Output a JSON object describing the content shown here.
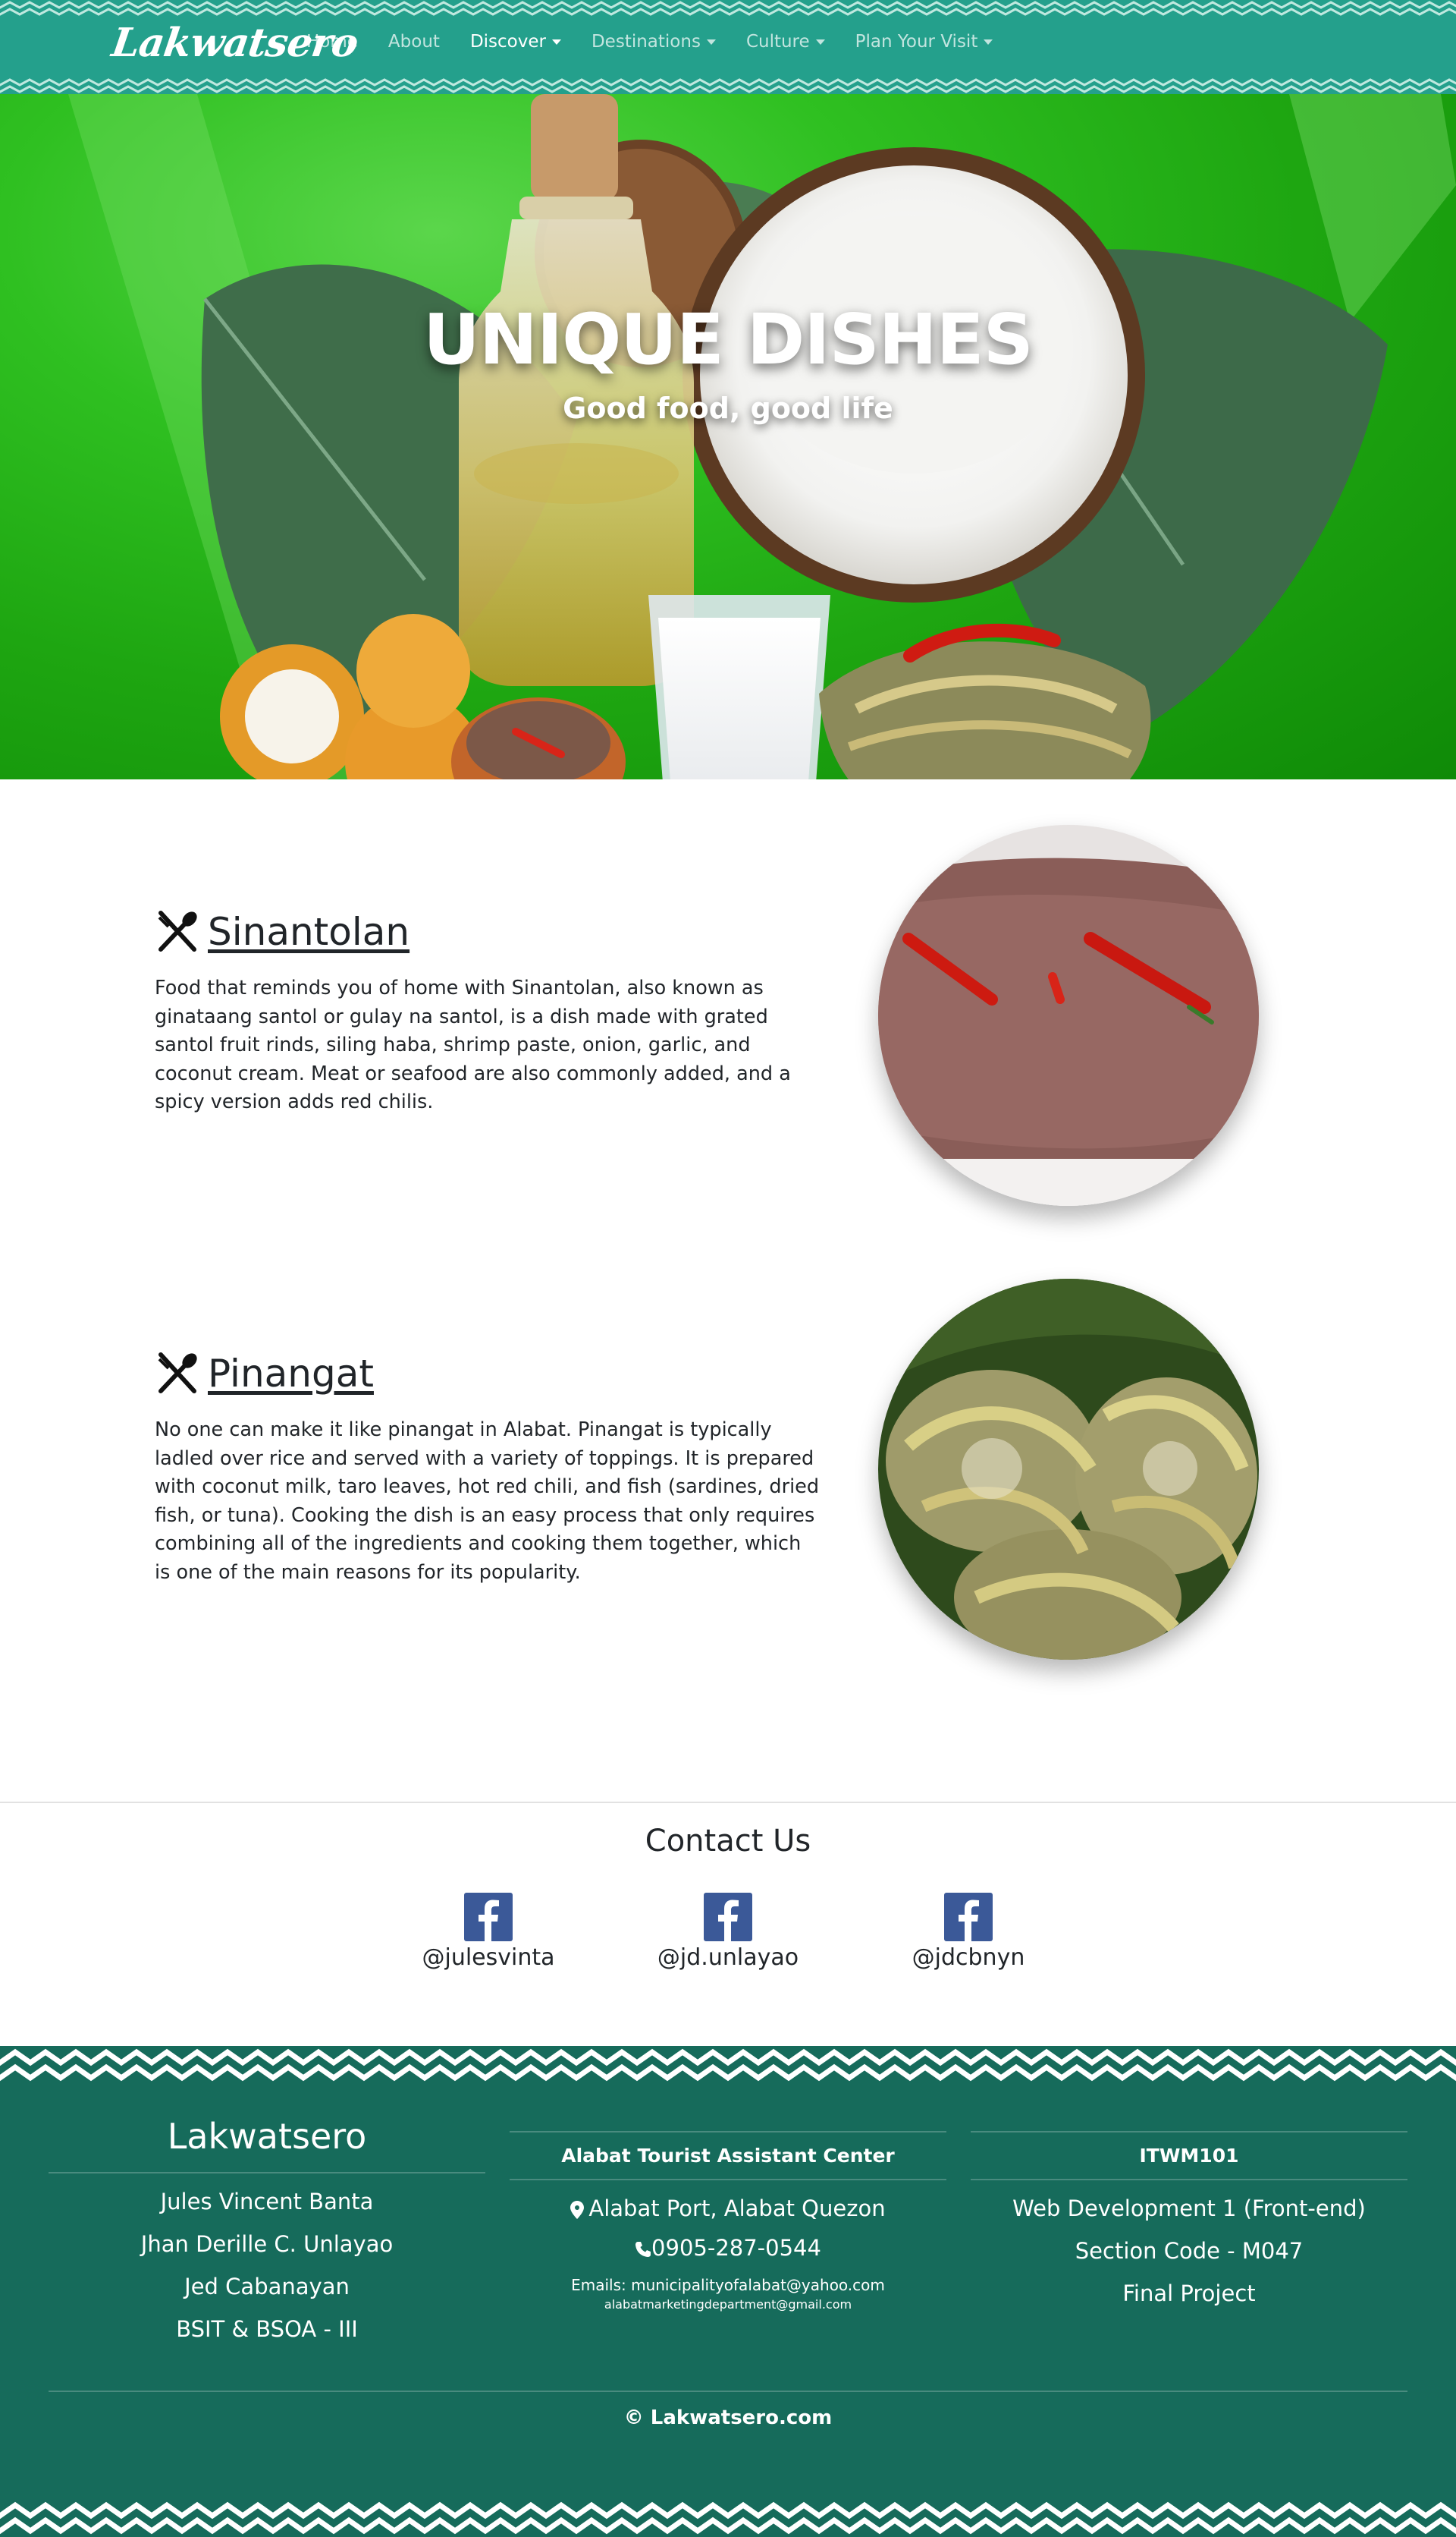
{
  "navbar": {
    "brand": "Lakwatsero",
    "links": [
      {
        "label": "Home"
      },
      {
        "label": "About"
      },
      {
        "label": "Discover"
      },
      {
        "label": "Destinations"
      },
      {
        "label": "Culture"
      },
      {
        "label": "Plan Your Visit"
      }
    ],
    "active": "Discover",
    "background_color": "#24a08c"
  },
  "hero": {
    "title": "UNIQUE DISHES",
    "subtitle": "Good food, good life"
  },
  "dishes": [
    {
      "icon": "fork-knife-icon",
      "name": "Sinantolan",
      "description": "Food that reminds you of home with Sinantolan, also known as ginataang santol or gulay na santol, is a dish made with grated santol fruit rinds, siling haba, shrimp paste, onion, garlic, and coconut cream. Meat or seafood are also commonly added, and a spicy version adds red chilis."
    },
    {
      "icon": "fork-knife-icon",
      "name": "Pinangat",
      "description": "No one can make it like pinangat in Alabat. Pinangat is typically ladled over rice and served with a variety of toppings. It is prepared with coconut milk, taro leaves, hot red chili, and fish (sardines, dried fish, or tuna). Cooking the dish is an easy process that only requires combining all of the ingredients and cooking them together, which is one of the main reasons for its popularity."
    }
  ],
  "contact": {
    "title": "Contact Us",
    "socials": [
      {
        "icon": "facebook-icon",
        "handle": "@julesvinta"
      },
      {
        "icon": "facebook-icon",
        "handle": "@jd.unlayao"
      },
      {
        "icon": "facebook-icon",
        "handle": "@jdcbnyn"
      }
    ]
  },
  "footer": {
    "col1": {
      "title": "Lakwatsero",
      "items": [
        "Jules Vincent Banta",
        "Jhan Derille C. Unlayao",
        "Jed Cabanayan",
        "BSIT & BSOA - III"
      ]
    },
    "col2": {
      "title": "Alabat Tourist Assistant Center",
      "address": "Alabat Port, Alabat Quezon",
      "phone": "0905-287-0544",
      "emails_label": "Emails: municipalityofalabat@yahoo.com",
      "email2": "alabatmarketingdepartment@gmail.com"
    },
    "col3": {
      "title": "ITWM101",
      "items": [
        "Web Development 1 (Front-end)",
        "Section Code - M047",
        "Final Project"
      ]
    },
    "copyright": "© Lakwatsero.com",
    "background_color": "#166b5b"
  }
}
